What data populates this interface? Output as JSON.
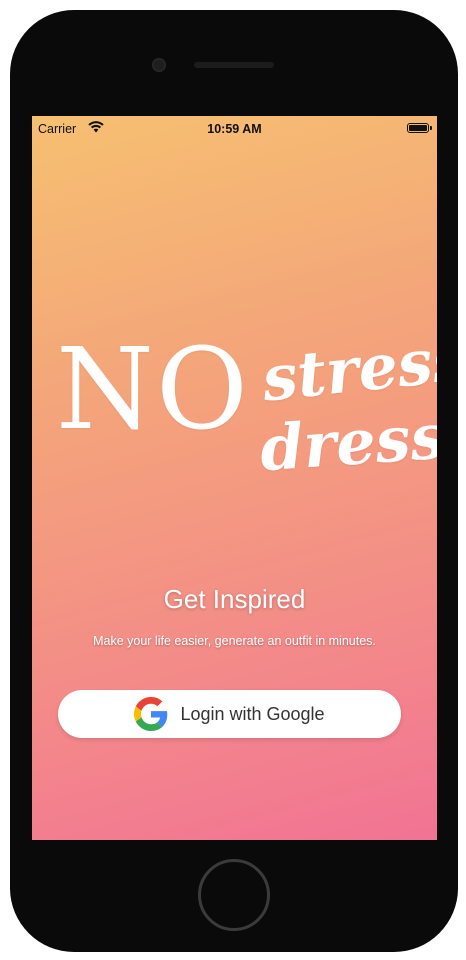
{
  "status_bar": {
    "carrier": "Carrier",
    "time": "10:59 AM",
    "wifi_icon": "wifi-icon",
    "battery_icon": "battery-icon"
  },
  "logo": {
    "no": "NO",
    "stress": "stress",
    "dress": "dress"
  },
  "hero": {
    "headline": "Get Inspired",
    "subline": "Make your life easier, generate an outfit in minutes."
  },
  "login": {
    "label": "Login with Google",
    "icon": "google-icon"
  },
  "colors": {
    "gradient_top": "#f6c071",
    "gradient_bottom": "#f27394",
    "button_bg": "#ffffff",
    "text": "#ffffff"
  }
}
